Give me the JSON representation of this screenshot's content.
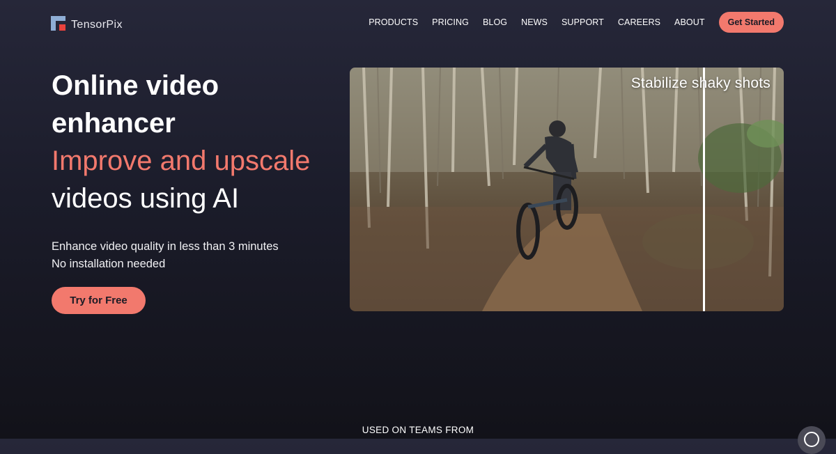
{
  "brand": {
    "name": "TensorPix",
    "colors": {
      "accent": "#f2796d",
      "logo_blue": "#8faed6",
      "logo_red": "#e8423d"
    }
  },
  "nav": {
    "items": [
      "PRODUCTS",
      "PRICING",
      "BLOG",
      "NEWS",
      "SUPPORT",
      "CAREERS",
      "ABOUT"
    ],
    "cta": "Get Started"
  },
  "hero": {
    "title_line1": "Online video",
    "title_line2": "enhancer",
    "title_accent": "Improve and upscale",
    "title_line4": "videos using AI",
    "sub_line1": "Enhance video quality in less than 3 minutes",
    "sub_line2": "No installation needed",
    "button": "Try for Free"
  },
  "video": {
    "caption": "Stabilize shaky shots"
  },
  "footer": {
    "used_on": "USED ON TEAMS FROM"
  },
  "icons": {
    "logo": "tensorpix-logo-icon",
    "chat": "chat-icon"
  }
}
